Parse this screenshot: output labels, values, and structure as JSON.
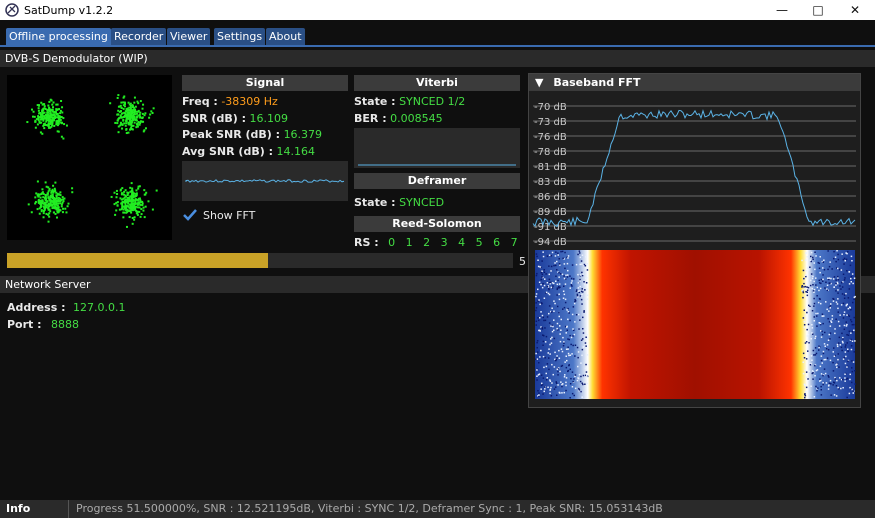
{
  "window": {
    "title": "SatDump v1.2.2"
  },
  "menu": {
    "tabs": [
      "Offline processing",
      "Recorder",
      "Viewer",
      "Settings",
      "About"
    ]
  },
  "demod": {
    "title": "DVB-S Demodulator (WIP)"
  },
  "signal": {
    "header": "Signal",
    "freq_label": "Freq :",
    "freq_value": "-38309 Hz",
    "snr_label": "SNR (dB) :",
    "snr_value": "16.109",
    "peak_label": "Peak SNR (dB) :",
    "peak_value": "16.379",
    "avg_label": "Avg SNR (dB) :",
    "avg_value": "14.164",
    "show_fft_label": "Show FFT",
    "show_fft_checked": true
  },
  "viterbi": {
    "header": "Viterbi",
    "state_label": "State :",
    "state_value": "SYNCED 1/2",
    "ber_label": "BER :",
    "ber_value": "0.008545"
  },
  "deframer": {
    "header": "Deframer",
    "state_label": "State :",
    "state_value": "SYNCED"
  },
  "rs": {
    "header": "Reed-Solomon",
    "label": "RS :",
    "values": [
      "0",
      "1",
      "2",
      "3",
      "4",
      "5",
      "6",
      "7"
    ]
  },
  "progress": {
    "fraction": 0.515,
    "label": "5"
  },
  "fft": {
    "title": "Baseband FFT",
    "db_labels": [
      "-70 dB",
      "-73 dB",
      "-76 dB",
      "-78 dB",
      "-81 dB",
      "-83 dB",
      "-86 dB",
      "-89 dB",
      "-91 dB",
      "-94 dB"
    ]
  },
  "network": {
    "title": "Network Server",
    "address_label": "Address :",
    "address_value": "127.0.0.1",
    "port_label": "Port :",
    "port_value": "8888"
  },
  "status": {
    "label": "Info",
    "text": "Progress 51.500000%, SNR : 12.521195dB, Viterbi : SYNC 1/2, Deframer Sync : 1, Peak SNR: 15.053143dB"
  },
  "colors": {
    "accent": "#3a6bb0",
    "green": "#44dd44",
    "orange": "#ff9d1c",
    "progress": "#c9a227",
    "fft_line": "#5bb3e6"
  }
}
